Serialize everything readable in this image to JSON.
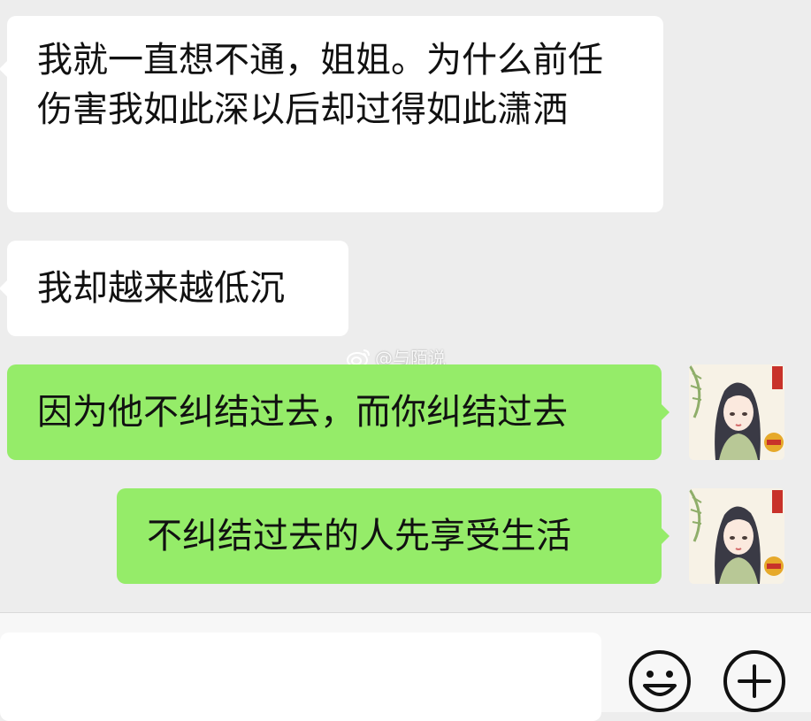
{
  "messages": [
    {
      "side": "incoming",
      "text": "我就一直想不通，姐姐。为什么前任伤害我如此深以后却过得如此潇洒"
    },
    {
      "side": "incoming",
      "text": "我却越来越低沉"
    },
    {
      "side": "outgoing",
      "text": "因为他不纠结过去，而你纠结过去"
    },
    {
      "side": "outgoing",
      "text": "不纠结过去的人先享受生活"
    }
  ],
  "watermark": {
    "icon": "weibo-icon",
    "text": "@与陌说"
  },
  "footer": {
    "input_value": "",
    "emoji_icon": "smiley-face-icon",
    "plus_icon": "plus-circle-icon"
  },
  "colors": {
    "background": "#ededed",
    "incoming_bubble": "#ffffff",
    "outgoing_bubble": "#95ec69",
    "text": "#111111"
  }
}
